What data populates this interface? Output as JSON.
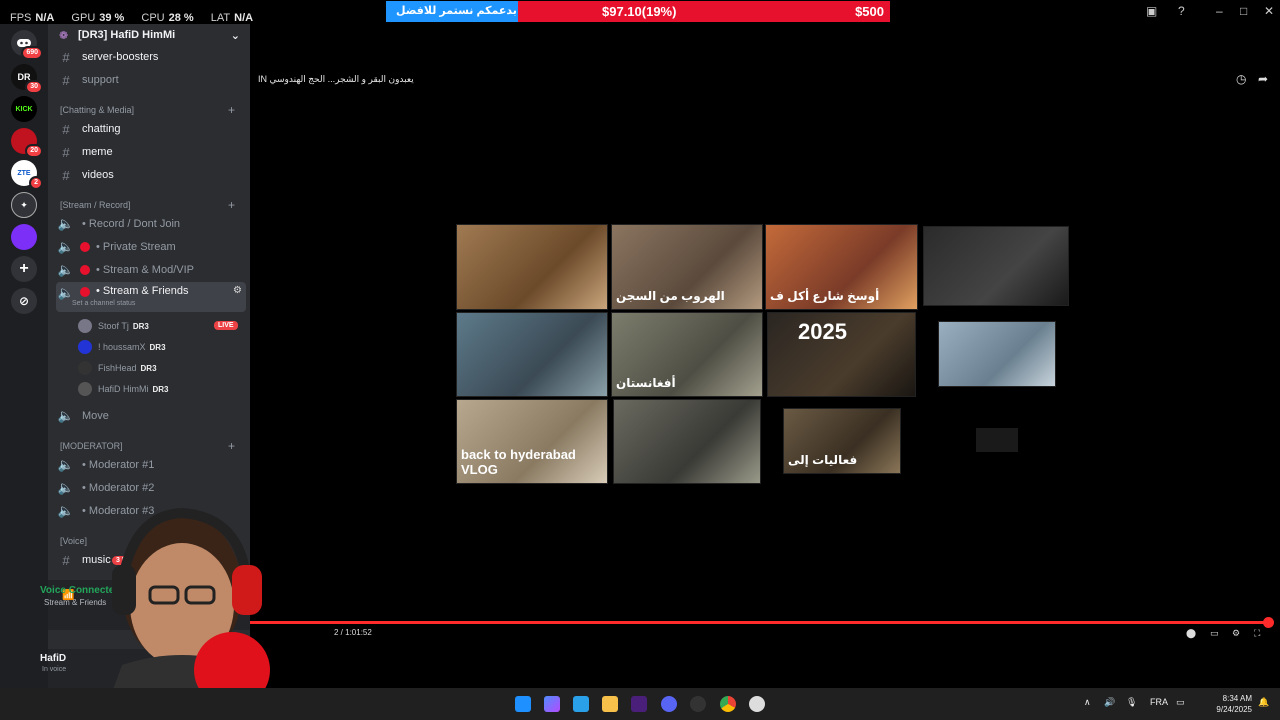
{
  "stats": {
    "fps_label": "FPS",
    "fps": "N/A",
    "gpu_label": "GPU",
    "gpu": "39 %",
    "cpu_label": "CPU",
    "cpu": "28 %",
    "lat_label": "LAT",
    "lat": "N/A"
  },
  "donation": {
    "text": "بدعمكم نستمر للافضل",
    "amount": "$97.10(19%)",
    "goal": "$500",
    "progress_fraction": 0.19
  },
  "rail": {
    "badge_top": "690",
    "badge_dr": "30",
    "badge_red": "20",
    "badge_zte": "2",
    "dr_label": "DR",
    "kick_label": "KICK",
    "zte_label": "ZTE"
  },
  "sidebar": {
    "server_name": "[DR3] HafiD HimMi",
    "channels_top": [
      {
        "label": "server-boosters"
      },
      {
        "label": "support"
      }
    ],
    "cat_chatting": "[Chatting & Media]",
    "chatting_channels": [
      {
        "label": "chatting"
      },
      {
        "label": "meme"
      },
      {
        "label": "videos"
      }
    ],
    "cat_stream": "[Stream / Record]",
    "stream_channels": [
      {
        "label": "• Record / Dont Join"
      },
      {
        "label": "• Private Stream"
      },
      {
        "label": "• Stream & Mod/VIP"
      },
      {
        "label": "• Stream & Friends"
      }
    ],
    "set_status": "Set a channel status",
    "users": [
      {
        "name": "Stoof Tj",
        "tag": "DR3"
      },
      {
        "name": "! houssamX",
        "tag": "DR3"
      },
      {
        "name": "FishHead",
        "tag": "DR3"
      },
      {
        "name": "HafiD HimMi",
        "tag": "DR3"
      }
    ],
    "live": "LIVE",
    "move": "Move",
    "cat_moderator": "[MODERATOR]",
    "mod_channels": [
      {
        "label": "• Moderator #1"
      },
      {
        "label": "• Moderator #2"
      },
      {
        "label": "• Moderator #3"
      }
    ],
    "cat_voice": "[Voice]",
    "music": "music",
    "new_badge": "3 NE",
    "voice_connected": "Voice Connected",
    "voice_channel": "Stream & Friends",
    "me_name": "HafiD",
    "me_status": "In voice"
  },
  "video": {
    "title": "IN يعبدون البقر و الشجر... الحج الهندوسي",
    "timecode": "2 / 1:01:52",
    "progress_fraction": 0.995,
    "thumbnails": [
      {
        "text": ""
      },
      {
        "text": "الهروب من السجن"
      },
      {
        "text": "أوسخ شارع أكل ف"
      },
      {
        "text": ""
      },
      {
        "text": ""
      },
      {
        "text": "أفغانستان"
      },
      {
        "text": "2025"
      },
      {
        "text": ""
      },
      {
        "text": "back to hyderabad VLOG"
      },
      {
        "text": ""
      },
      {
        "text": "فعاليات إلى"
      }
    ]
  },
  "taskbar": {
    "lang": "FRA",
    "time": "8:34 AM",
    "date": "9/24/2025"
  },
  "colors": {
    "accent_red": "#e8112d",
    "donation_blue": "#1f96ff",
    "live_red": "#ed4245",
    "sidebar_bg": "#2b2d31",
    "rail_bg": "#1e1f22"
  }
}
